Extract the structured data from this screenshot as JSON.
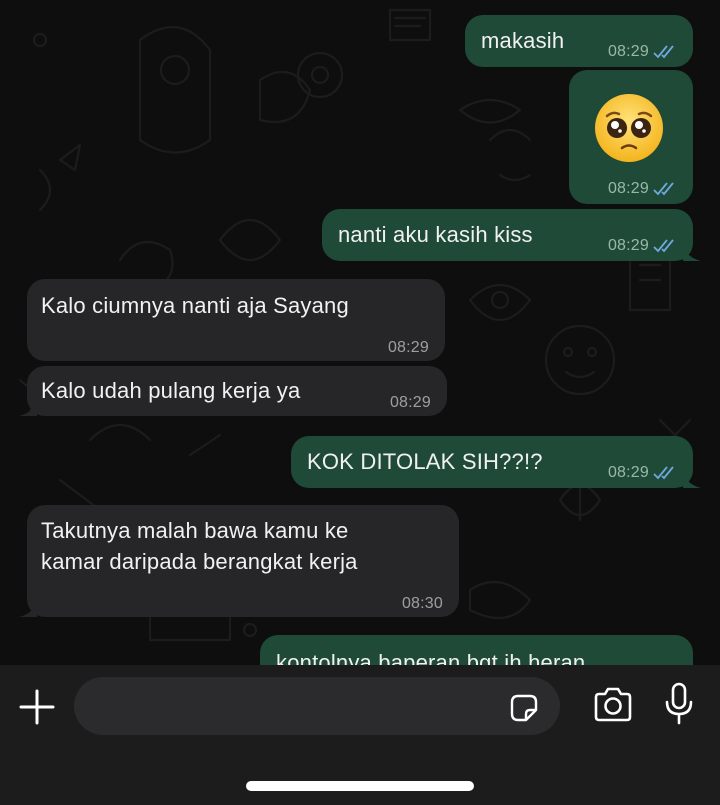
{
  "messages": [
    {
      "id": "m1",
      "dir": "out",
      "text": "makasih",
      "time": "08:29",
      "read": true
    },
    {
      "id": "m2",
      "dir": "out",
      "emoji": "pleading-face",
      "time": "08:29",
      "read": true
    },
    {
      "id": "m3",
      "dir": "out",
      "text": "nanti aku kasih kiss",
      "time": "08:29",
      "read": true
    },
    {
      "id": "m4",
      "dir": "in",
      "text": "Kalo ciumnya nanti aja Sayang",
      "time": "08:29"
    },
    {
      "id": "m5",
      "dir": "in",
      "text": "Kalo udah pulang kerja ya",
      "time": "08:29"
    },
    {
      "id": "m6",
      "dir": "out",
      "text": "KOK DITOLAK SIH??!?",
      "time": "08:29",
      "read": true
    },
    {
      "id": "m7",
      "dir": "in",
      "text_lines": [
        "Takutnya malah bawa kamu ke",
        "kamar daripada berangkat kerja"
      ],
      "time": "08:30"
    },
    {
      "id": "m8",
      "dir": "out",
      "text": "kontolnya baperan bgt ih heran",
      "partial": true
    }
  ],
  "composer": {
    "input_value": "",
    "icons": [
      "plus-icon",
      "sticker-icon",
      "camera-icon",
      "microphone-icon"
    ]
  },
  "colors": {
    "outgoing_bubble": "#1e4a37",
    "incoming_bubble": "#262628",
    "read_ticks": "#6fa8dc",
    "background": "#0e0e0e"
  }
}
